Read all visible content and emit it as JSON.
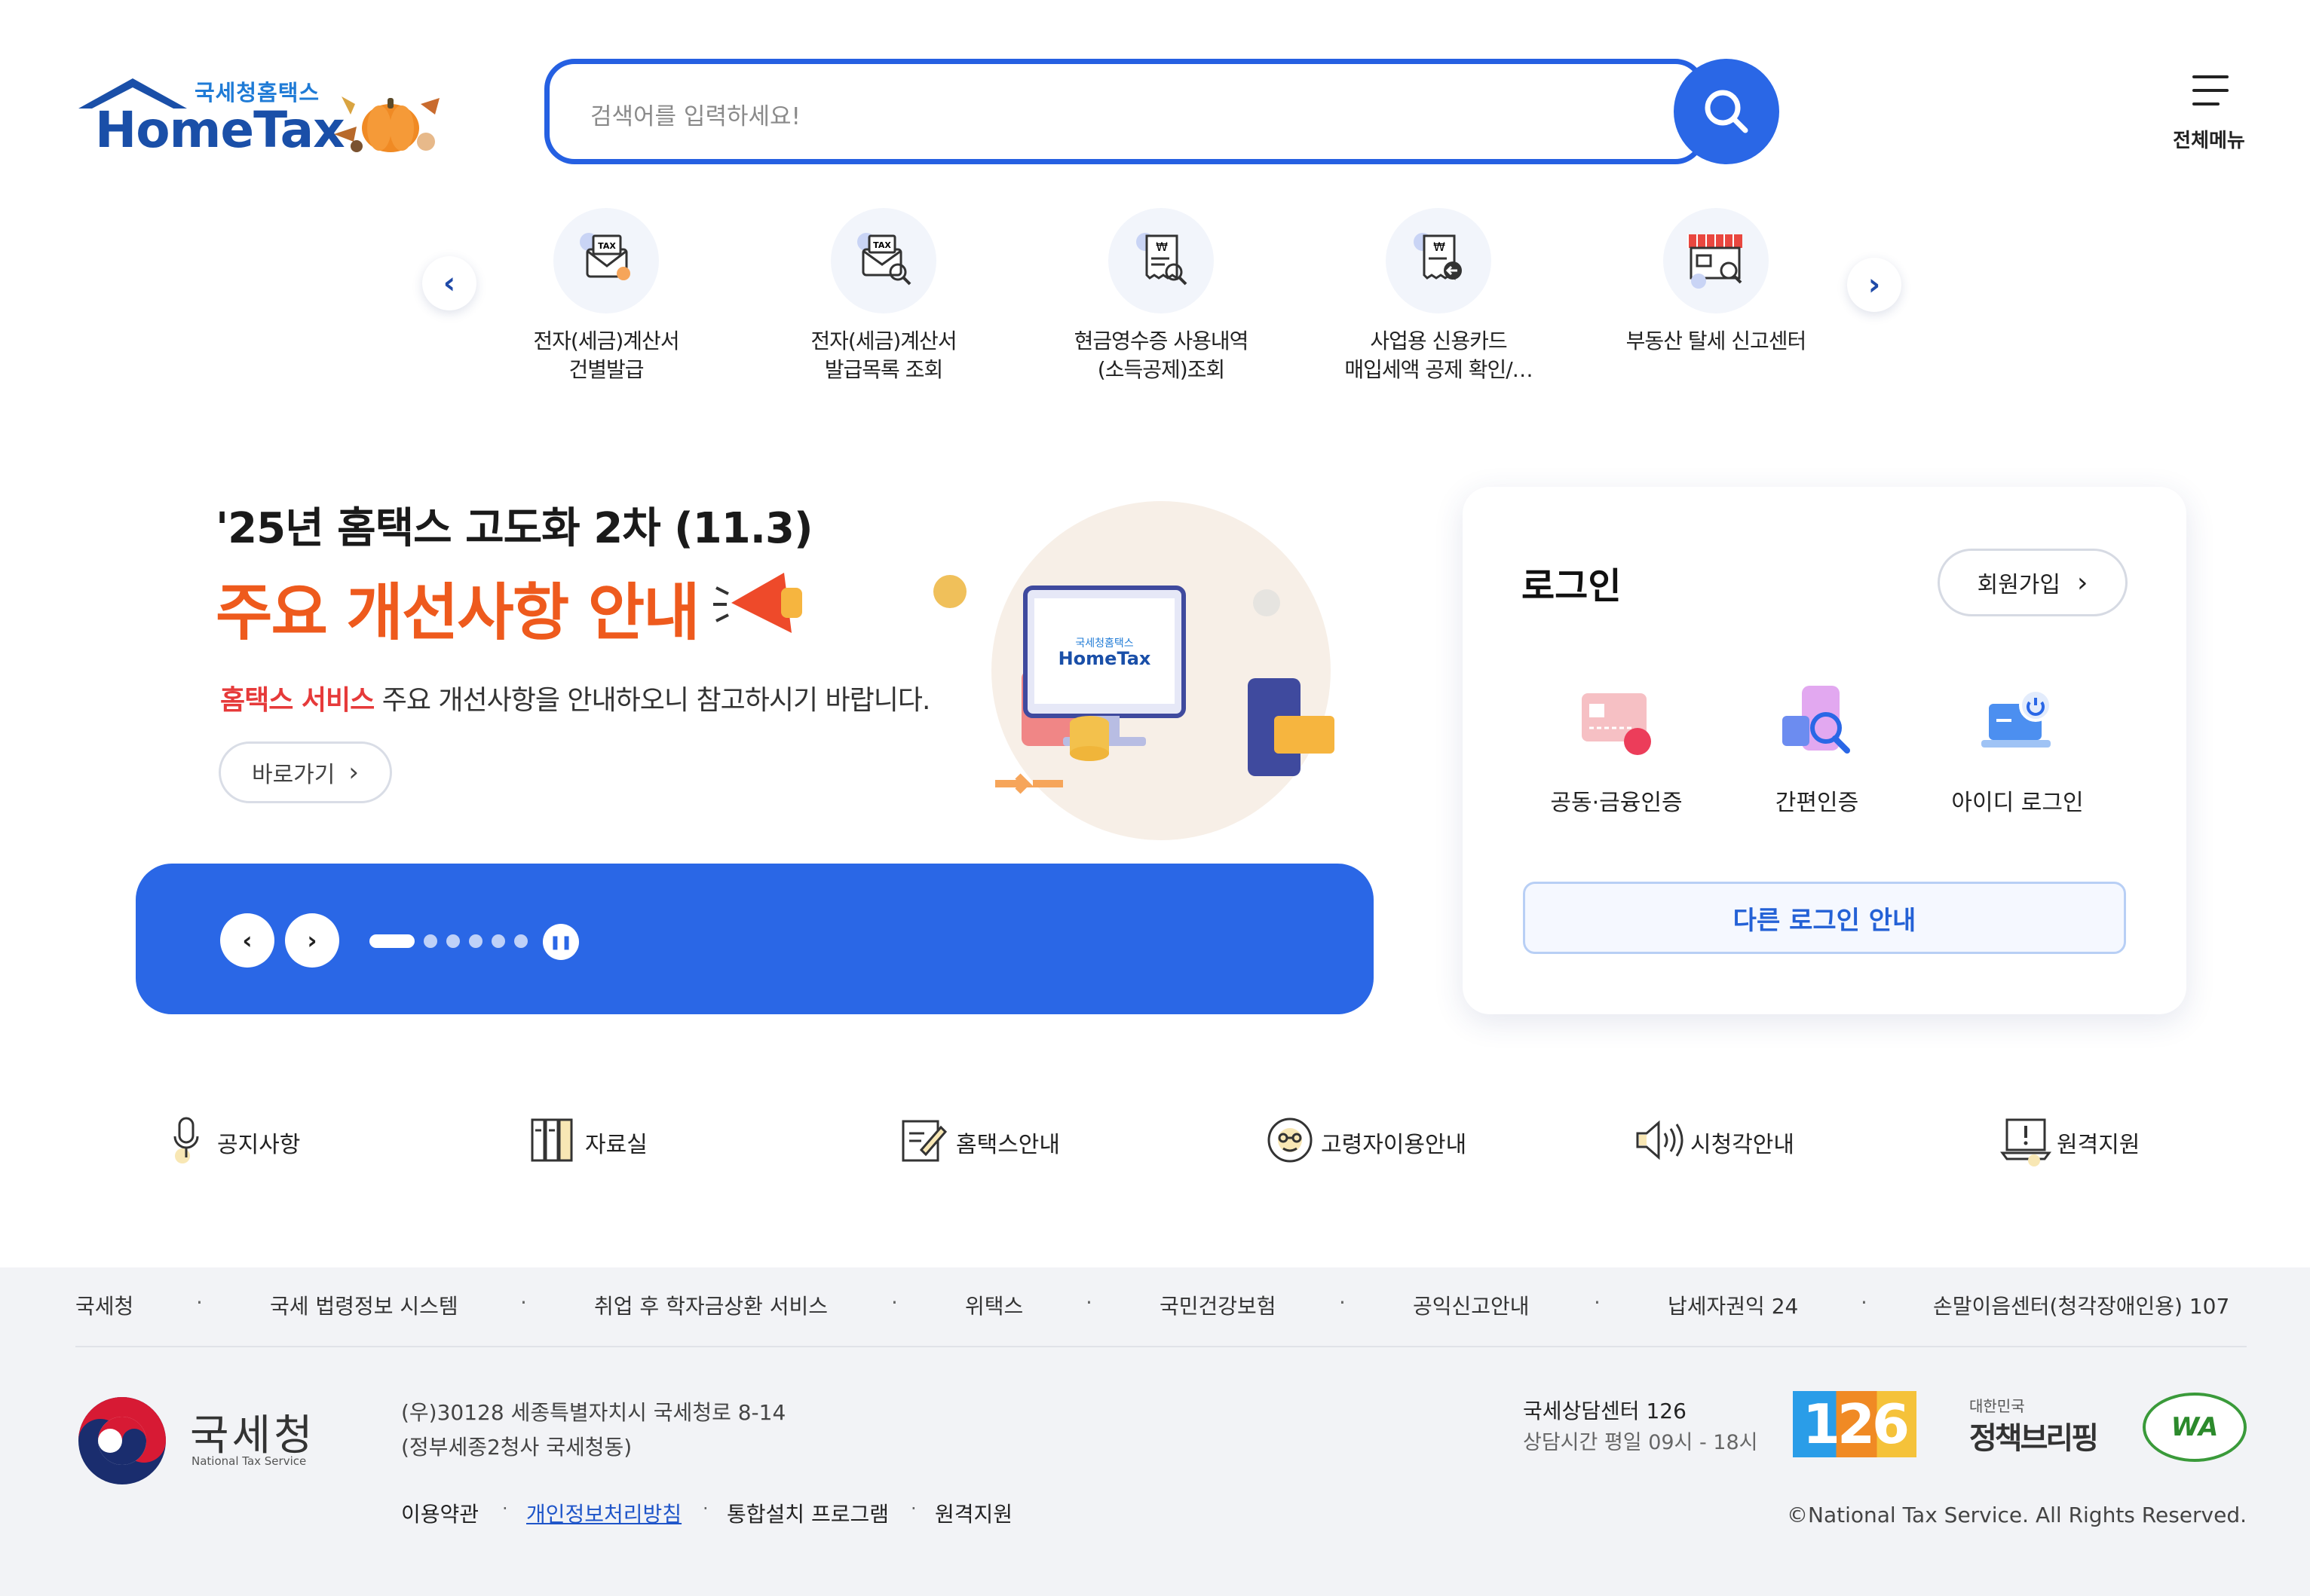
{
  "header": {
    "logo_sub": "국세청홈택스",
    "logo_main": "HomeTax",
    "search_placeholder": "검색어를 입력하세요!",
    "menu_label": "전체메뉴"
  },
  "quick_menu": [
    {
      "line1": "전자(세금)계산서",
      "line2": "건별발급",
      "icon": "tax-invoice-icon"
    },
    {
      "line1": "전자(세금)계산서",
      "line2": "발급목록 조회",
      "icon": "tax-invoice-search-icon"
    },
    {
      "line1": "현금영수증 사용내역",
      "line2": "(소득공제)조회",
      "icon": "cash-receipt-icon"
    },
    {
      "line1": "사업용 신용카드",
      "line2": "매입세액 공제 확인/…",
      "icon": "credit-card-receipt-icon"
    },
    {
      "line1": "부동산 탈세 신고센터",
      "line2": "",
      "icon": "store-search-icon"
    }
  ],
  "banner": {
    "line1": "'25년 홈택스 고도화 2차 (11.3)",
    "line2": "주요 개선사항 안내",
    "line3_highlight": "홈택스 서비스",
    "line3_rest": " 주요 개선사항을 안내하오니 참고하시기 바랍니다.",
    "button": "바로가기",
    "illustration_logo_sub": "국세청홈택스",
    "illustration_logo_main": "HomeTax",
    "slides_total": 6,
    "active_slide": 1
  },
  "login": {
    "title": "로그인",
    "signup": "회원가입",
    "methods": [
      {
        "label": "공동·금융인증",
        "icon": "certificate-card-icon"
      },
      {
        "label": "간편인증",
        "icon": "phone-search-icon"
      },
      {
        "label": "아이디 로그인",
        "icon": "laptop-power-icon"
      }
    ],
    "other": "다른 로그인 안내"
  },
  "services": [
    {
      "label": "공지사항",
      "icon": "microphone-icon"
    },
    {
      "label": "자료실",
      "icon": "binder-icon"
    },
    {
      "label": "홈택스안내",
      "icon": "edit-document-icon"
    },
    {
      "label": "고령자이용안내",
      "icon": "senior-icon"
    },
    {
      "label": "시청각안내",
      "icon": "speaker-icon"
    },
    {
      "label": "원격지원",
      "icon": "laptop-alert-icon"
    }
  ],
  "footer": {
    "links": [
      "국세청",
      "국세 법령정보 시스템",
      "취업 후 학자금상환 서비스",
      "위택스",
      "국민건강보험",
      "공익신고안내",
      "납세자권익 24",
      "손말이음센터(청각장애인용) 107"
    ],
    "org_name": "국세청",
    "org_name_en": "National Tax Service",
    "address1": "(우)30128 세종특별자치시 국세청로 8-14",
    "address2": "(정부세종2청사 국세청동)",
    "bottom_links": [
      "이용약관",
      "개인정보처리방침",
      "통합설치 프로그램",
      "원격지원"
    ],
    "call_center": "국세상담센터 126",
    "hours": "상담시간 평일 09시 - 18시",
    "badge_126": "126",
    "badge_policy_top": "대한민국",
    "badge_policy": "정책브리핑",
    "badge_wa": "WA",
    "copyright": "©National Tax Service. All Rights Reserved."
  },
  "colors": {
    "primary": "#2a67e6",
    "logo_blue": "#1a4fa8",
    "banner_orange": "#ee5a1d",
    "highlight_red": "#e63a3a"
  }
}
